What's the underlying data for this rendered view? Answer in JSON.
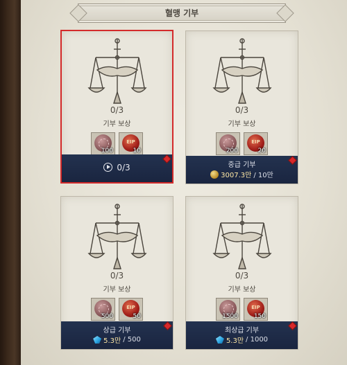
{
  "header": {
    "title": "혈맹 기부"
  },
  "cards": [
    {
      "progress": "0/3",
      "reward_label": "기부 보상",
      "rewards": [
        {
          "type": "stone",
          "qty": "100"
        },
        {
          "type": "ruby",
          "qty": "10"
        }
      ],
      "bar": {
        "mode": "progress",
        "text": "0/3"
      },
      "selected": true
    },
    {
      "progress": "0/3",
      "reward_label": "기부 보상",
      "rewards": [
        {
          "type": "stone",
          "qty": "200"
        },
        {
          "type": "ruby",
          "qty": "20"
        }
      ],
      "bar": {
        "mode": "cost",
        "title": "중급 기부",
        "currency_icon": "gold-coin-icon",
        "value": "3007.3만",
        "max": "/ 10만"
      }
    },
    {
      "progress": "0/3",
      "reward_label": "기부 보상",
      "rewards": [
        {
          "type": "stone",
          "qty": "500"
        },
        {
          "type": "ruby",
          "qty": "50"
        }
      ],
      "bar": {
        "mode": "cost",
        "title": "상급 기부",
        "currency_icon": "diamond-icon",
        "value": "5.3만",
        "max": "/ 500"
      }
    },
    {
      "progress": "0/3",
      "reward_label": "기부 보상",
      "rewards": [
        {
          "type": "stone",
          "qty": "1500"
        },
        {
          "type": "ruby",
          "qty": "150"
        }
      ],
      "bar": {
        "mode": "cost",
        "title": "최상급 기부",
        "currency_icon": "diamond-icon",
        "value": "5.3만",
        "max": "/ 1000"
      }
    }
  ]
}
